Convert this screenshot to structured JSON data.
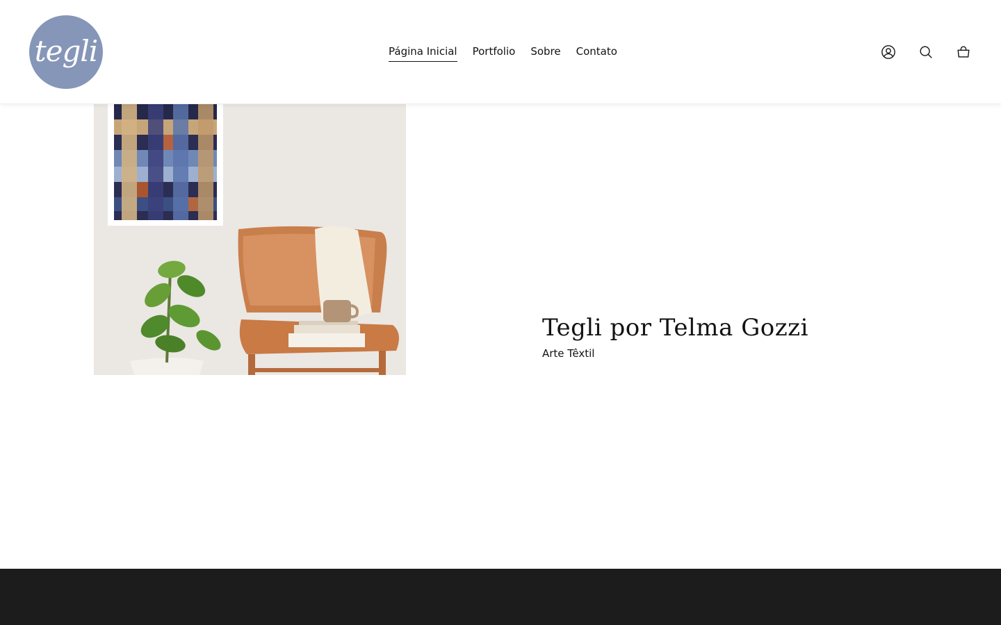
{
  "brand": {
    "logo_text": "tegli",
    "logo_color": "#8696b8"
  },
  "nav": {
    "items": [
      {
        "label": "Página Inicial",
        "active": true
      },
      {
        "label": "Portfolio",
        "active": false
      },
      {
        "label": "Sobre",
        "active": false
      },
      {
        "label": "Contato",
        "active": false
      }
    ]
  },
  "header_icons": [
    "account-icon",
    "search-icon",
    "cart-icon"
  ],
  "hero": {
    "title": "Tegli por Telma Gozzi",
    "subtitle": "Arte Têxtil"
  },
  "colors": {
    "footer_bg": "#1c1c1c",
    "text": "#121212"
  }
}
